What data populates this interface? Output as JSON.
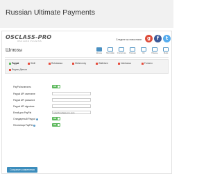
{
  "app": {
    "title": "Russian Ultimate Payments"
  },
  "header": {
    "logo_text": "OSCLASS-PRO",
    "logo_subtext": "OSCLASS PLUGINS",
    "social_text": "Следите за новостями:",
    "social": [
      {
        "icon": "google-plus-icon",
        "glyph": "g",
        "color": "#dd4b39"
      },
      {
        "icon": "facebook-icon",
        "glyph": "f",
        "color": "#3b5998"
      },
      {
        "icon": "twitter-icon",
        "glyph": "t",
        "color": "#55acee"
      }
    ]
  },
  "page_title": "Шлюзы",
  "nav": [
    {
      "label": "Шлюзы",
      "icon": "gateways-icon",
      "active": true
    },
    {
      "label": "Настройки",
      "icon": "settings-icon"
    },
    {
      "label": "Статистика",
      "icon": "stats-icon"
    },
    {
      "label": "Платежи",
      "icon": "payments-icon"
    },
    {
      "label": "Лог",
      "icon": "log-icon"
    },
    {
      "label": "Помощь",
      "icon": "help-icon"
    },
    {
      "label": "Инфо",
      "icon": "info-icon"
    }
  ],
  "tabs": [
    {
      "label": "Paypal",
      "color": "#5cb85c",
      "active": true
    },
    {
      "label": "Skrill",
      "color": "#e74c3c"
    },
    {
      "label": "Robokassa",
      "color": "#e74c3c"
    },
    {
      "label": "Webmoney",
      "color": "#e74c3c"
    },
    {
      "label": "Walletone",
      "color": "#e74c3c"
    },
    {
      "label": "Interkassa",
      "color": "#e74c3c"
    },
    {
      "label": "Fortumo",
      "color": "#e74c3c"
    },
    {
      "label": "Яндекс.Деньги",
      "color": "#e74c3c"
    }
  ],
  "form": {
    "fields": [
      {
        "label": "PayPal включить",
        "type": "toggle",
        "value": "ON"
      },
      {
        "label": "Paypal API username",
        "type": "input",
        "value": ""
      },
      {
        "label": "Paypal API password",
        "type": "input",
        "value": ""
      },
      {
        "label": "Paypal API signature",
        "type": "input",
        "value": ""
      },
      {
        "label": "Email для PayPal",
        "type": "input",
        "value": "sale@osclass-pro.com"
      },
      {
        "label": "Стандартный Paypal",
        "type": "toggle",
        "value": "ON",
        "help": true
      },
      {
        "label": "Песочница PayPal",
        "type": "toggle",
        "value": "ON",
        "help": true
      }
    ]
  },
  "save_button": "Сохранить изменения"
}
